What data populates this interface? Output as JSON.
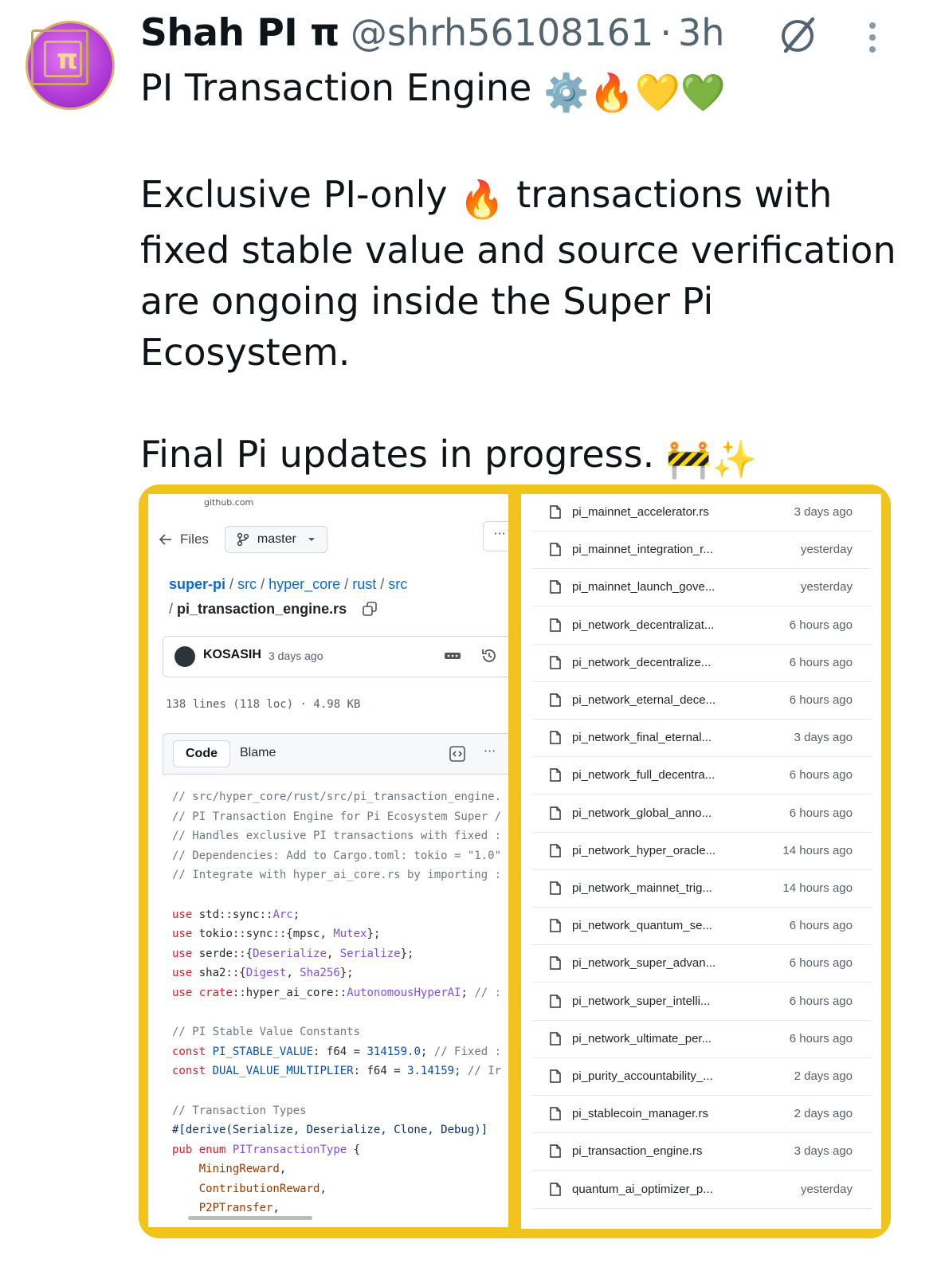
{
  "tweet": {
    "author_name": "Shah PI π",
    "handle": "@shrh56108161",
    "separator": "·",
    "time": "3h",
    "line1": "PI Transaction Engine",
    "para2_a": "Exclusive PI-only",
    "para2_b": "transactions with fixed stable value and source verification are ongoing inside the Super Pi Ecosystem.",
    "para3": "Final Pi updates in progress.",
    "emojis_line1": [
      "⚙️",
      "🔥",
      "💛",
      "💚"
    ],
    "emoji_para2": "🔥",
    "emojis_para3": [
      "🚧",
      "✨"
    ]
  },
  "icons": {
    "grok": "grok-icon",
    "more": "more-vertical-icon"
  },
  "colors": {
    "frame": "#f0c41c",
    "link": "#0969da",
    "avatar": "#b13ad6"
  },
  "left_screenshot": {
    "site": "github.com",
    "files_label": "Files",
    "branch": "master",
    "breadcrumb": [
      "super-pi",
      "src",
      "hyper_core",
      "rust",
      "src"
    ],
    "breadcrumb_sep": "/",
    "filename": "pi_transaction_engine.rs",
    "commit_user": "KOSASIH",
    "commit_time": "3 days ago",
    "meta": "138 lines (118 loc) · 4.98 KB",
    "tab_code": "Code",
    "tab_blame": "Blame",
    "more_dots": "···"
  },
  "file_list": [
    {
      "name": "pi_mainnet_accelerator.rs",
      "time": "3 days ago"
    },
    {
      "name": "pi_mainnet_integration_r...",
      "time": "yesterday"
    },
    {
      "name": "pi_mainnet_launch_gove...",
      "time": "yesterday"
    },
    {
      "name": "pi_network_decentralizat...",
      "time": "6 hours ago"
    },
    {
      "name": "pi_network_decentralize...",
      "time": "6 hours ago"
    },
    {
      "name": "pi_network_eternal_dece...",
      "time": "6 hours ago"
    },
    {
      "name": "pi_network_final_eternal...",
      "time": "3 days ago"
    },
    {
      "name": "pi_network_full_decentra...",
      "time": "6 hours ago"
    },
    {
      "name": "pi_network_global_anno...",
      "time": "6 hours ago"
    },
    {
      "name": "pi_network_hyper_oracle...",
      "time": "14 hours ago"
    },
    {
      "name": "pi_network_mainnet_trig...",
      "time": "14 hours ago"
    },
    {
      "name": "pi_network_quantum_se...",
      "time": "6 hours ago"
    },
    {
      "name": "pi_network_super_advan...",
      "time": "6 hours ago"
    },
    {
      "name": "pi_network_super_intelli...",
      "time": "6 hours ago"
    },
    {
      "name": "pi_network_ultimate_per...",
      "time": "6 hours ago"
    },
    {
      "name": "pi_purity_accountability_...",
      "time": "2 days ago"
    },
    {
      "name": "pi_stablecoin_manager.rs",
      "time": "2 days ago"
    },
    {
      "name": "pi_transaction_engine.rs",
      "time": "3 days ago"
    },
    {
      "name": "quantum_ai_optimizer_p...",
      "time": "yesterday"
    }
  ]
}
